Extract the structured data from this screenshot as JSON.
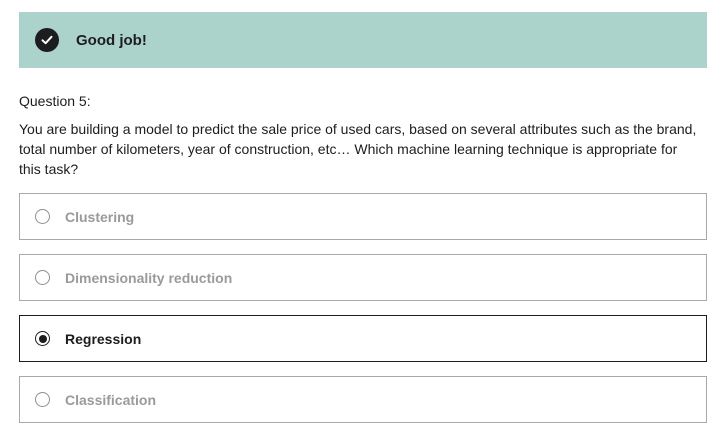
{
  "feedback": {
    "message": "Good job!",
    "icon": "check-circle-icon"
  },
  "question": {
    "label": "Question 5:",
    "text": "You are building a model to predict the sale price of used cars, based on several attributes such as the brand, total number of kilometers, year of construction, etc… Which machine learning technique is appropriate for this task?"
  },
  "options": [
    {
      "label": "Clustering",
      "selected": false
    },
    {
      "label": "Dimensionality reduction",
      "selected": false
    },
    {
      "label": "Regression",
      "selected": true
    },
    {
      "label": "Classification",
      "selected": false
    }
  ],
  "colors": {
    "banner_bg": "#acd2cc",
    "text": "#1c1d1f",
    "muted_option": "#9a9a9a"
  }
}
